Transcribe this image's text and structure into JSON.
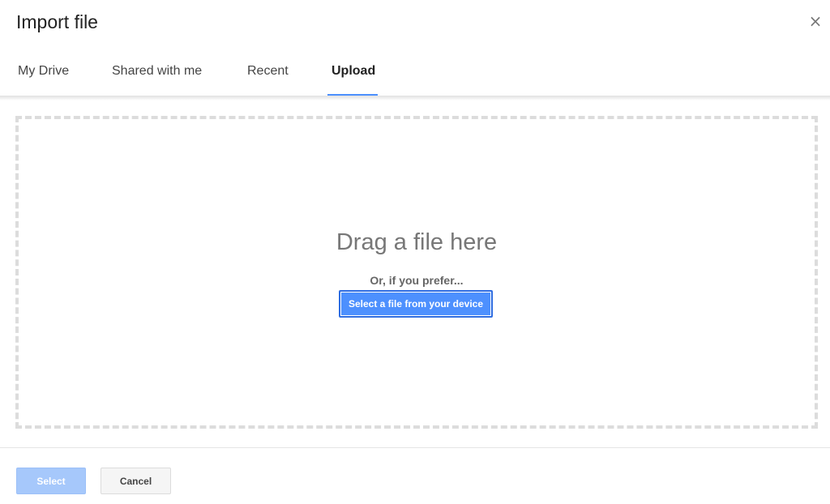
{
  "dialog": {
    "title": "Import file",
    "close_icon": "×"
  },
  "tabs": [
    {
      "label": "My Drive",
      "active": false
    },
    {
      "label": "Shared with me",
      "active": false
    },
    {
      "label": "Recent",
      "active": false
    },
    {
      "label": "Upload",
      "active": true
    }
  ],
  "upload": {
    "drag_text": "Drag a file here",
    "prefer_text": "Or, if you prefer...",
    "select_file_label": "Select a file from your device"
  },
  "footer": {
    "select_label": "Select",
    "cancel_label": "Cancel"
  },
  "colors": {
    "accent": "#4d90fe",
    "select_disabled": "#a6c8fb",
    "dropzone_border": "#dcdcdc"
  }
}
